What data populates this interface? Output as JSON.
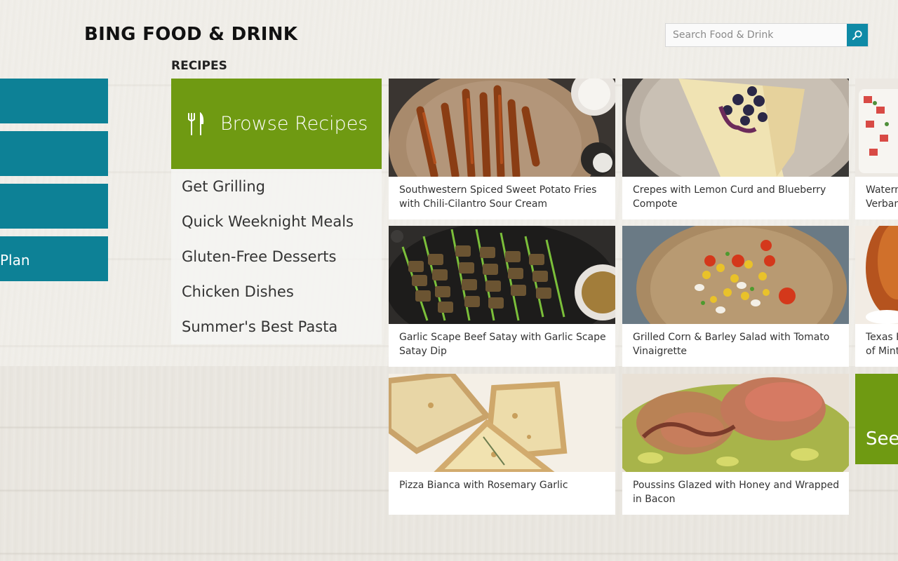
{
  "app": {
    "title": "BING FOOD & DRINK"
  },
  "search": {
    "placeholder": "Search Food & Drink",
    "icon": "search-icon"
  },
  "colors": {
    "accent": "#0f8aa6",
    "green_tile": "#6f9a12",
    "teal_tile": "#0d8196"
  },
  "left_tiles": [
    {
      "label": ""
    },
    {
      "label": ""
    },
    {
      "label": ""
    },
    {
      "label": "Plan"
    }
  ],
  "recipes": {
    "section_label": "RECIPES",
    "browse": {
      "label": "Browse Recipes",
      "icon": "fork-knife-icon"
    },
    "categories": [
      "Get Grilling",
      "Quick Weeknight Meals",
      "Gluten-Free Desserts",
      "Chicken Dishes",
      "Summer's Best Pasta"
    ],
    "cards": [
      {
        "title": "Southwestern Spiced Sweet Potato Fries with Chili-Cilantro Sour Cream",
        "image": "sweet-potato-fries"
      },
      {
        "title": "Crepes with Lemon Curd and Blueberry Compote",
        "image": "crepes-blueberry"
      },
      {
        "title": "Watern\nVerban",
        "image": "watermelon-salad"
      },
      {
        "title": "Garlic Scape Beef Satay with Garlic Scape Satay Dip",
        "image": "beef-satay"
      },
      {
        "title": "Grilled Corn & Barley Salad with Tomato Vinaigrette",
        "image": "corn-barley-salad"
      },
      {
        "title": "Texas F\nof Mint",
        "image": "texas-cake"
      },
      {
        "title": "Pizza Bianca with Rosemary Garlic",
        "image": "pizza-bianca"
      },
      {
        "title": "Poussins Glazed with Honey and Wrapped in Bacon",
        "image": "poussins-bacon"
      }
    ],
    "see_more_label": "See"
  }
}
